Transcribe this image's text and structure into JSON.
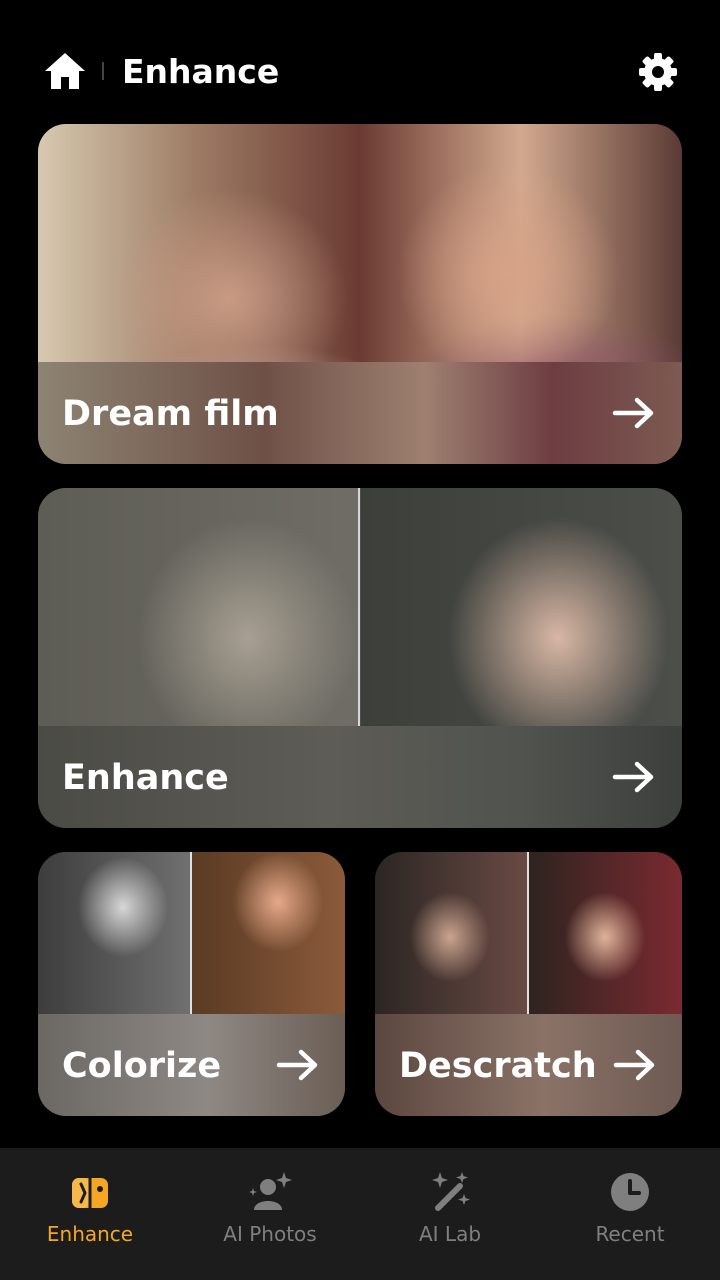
{
  "header": {
    "title": "Enhance"
  },
  "cards": {
    "dream": {
      "label": "Dream film"
    },
    "enhance": {
      "label": "Enhance"
    },
    "colorize": {
      "label": "Colorize"
    },
    "descratch": {
      "label": "Descratch"
    }
  },
  "nav": {
    "items": [
      {
        "label": "Enhance",
        "icon": "enhance-icon",
        "active": true
      },
      {
        "label": "AI Photos",
        "icon": "ai-photos-icon",
        "active": false
      },
      {
        "label": "AI Lab",
        "icon": "magic-wand-icon",
        "active": false
      },
      {
        "label": "Recent",
        "icon": "clock-icon",
        "active": false
      }
    ]
  },
  "colors": {
    "background": "#000000",
    "nav_background": "#1c1c1c",
    "accent": "#f5a623",
    "inactive": "#7f7f7f"
  }
}
